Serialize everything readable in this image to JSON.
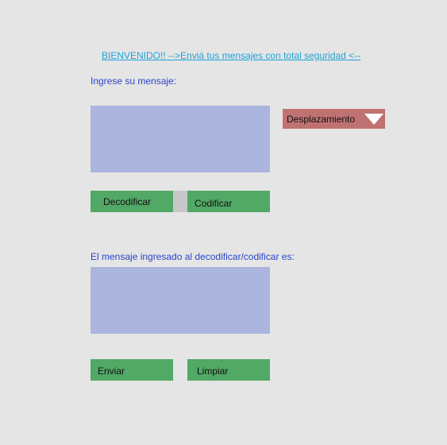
{
  "header": {
    "welcome_text": "BIENVENIDO!! -->Enviá tus mensajes con total seguridad <--"
  },
  "input_section": {
    "label": "Ingrese su mensaje:",
    "message_value": ""
  },
  "shift_select": {
    "selected_label": "Desplazamiento",
    "icon": "triangle-down-icon"
  },
  "actions": {
    "decode_label": "Decodificar",
    "encode_label": "Codificar"
  },
  "output_section": {
    "label": "El mensaje  ingresado al decodificar/codificar es:",
    "result_value": ""
  },
  "footer_actions": {
    "send_label": "Enviar",
    "clear_label": "Limpiar"
  },
  "colors": {
    "background": "#e5e5e5",
    "link": "#1fa2d8",
    "label": "#2b44c8",
    "textarea": "#abb5dd",
    "button": "#52a865",
    "dropdown": "#c07272"
  }
}
